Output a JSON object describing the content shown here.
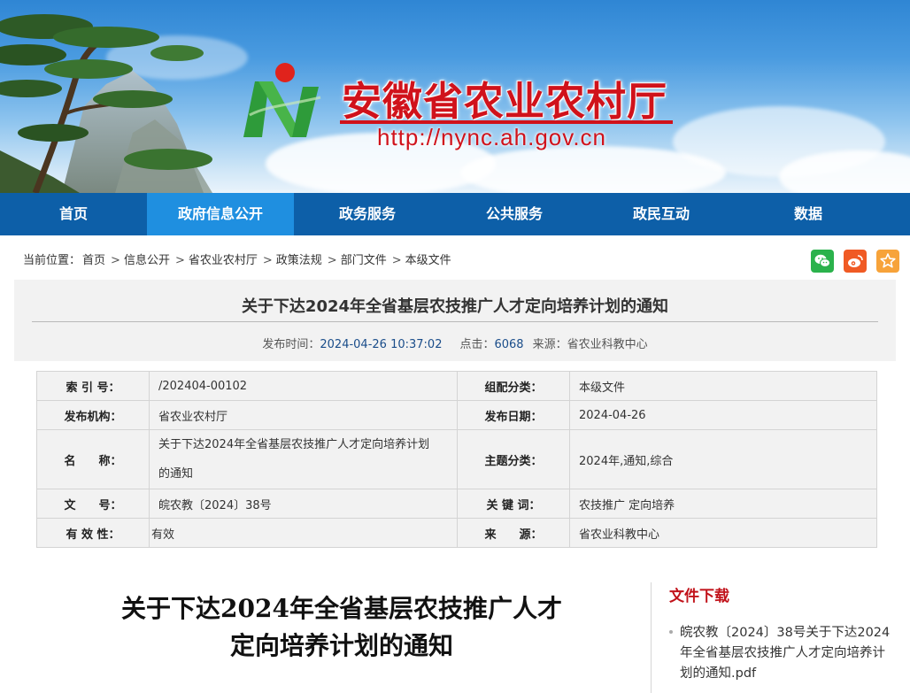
{
  "site": {
    "title": "安徽省农业农村厅",
    "url": "http://nync.ah.gov.cn"
  },
  "nav": {
    "items": [
      "首页",
      "政府信息公开",
      "政务服务",
      "公共服务",
      "政民互动",
      "数据"
    ],
    "active_index": 1
  },
  "breadcrumb": {
    "prefix": "当前位置：",
    "items": [
      "首页",
      "信息公开",
      "省农业农村厅",
      "政策法规",
      "部门文件",
      "本级文件"
    ],
    "separator": ">"
  },
  "share": {
    "icons": [
      "wechat-icon",
      "weibo-icon",
      "favorite-star-icon"
    ],
    "colors": [
      "#2bb24c",
      "#f05a24",
      "#f7a33a"
    ]
  },
  "article": {
    "title": "关于下达2024年全省基层农技推广人才定向培养计划的通知",
    "publish_label": "发布时间：",
    "publish_time": "2024-04-26 10:37:02",
    "clicks_label": "点击：",
    "clicks": "6068",
    "source_label": "来源：",
    "source": "省农业科教中心"
  },
  "info": {
    "index_label": "索 引 号：",
    "index_value": "/202404-00102",
    "category_label": "组配分类：",
    "category_value": "本级文件",
    "org_label": "发布机构：",
    "org_value": "省农业农村厅",
    "date_label": "发布日期：",
    "date_value": "2024-04-26",
    "name_label": "名　　称：",
    "name_value_1": "关于下达2024年全省基层农技推广人才定向培养计划",
    "name_value_2": "的通知",
    "topic_label": "主题分类：",
    "topic_value": "2024年,通知,综合",
    "docno_label": "文　　号：",
    "docno_value": "皖农教〔2024〕38号",
    "keyword_label": "关 键 词：",
    "keyword_value": "农技推广 定向培养",
    "valid_label": "有 效 性：",
    "valid_value": "有效",
    "src_label": "来　　源：",
    "src_value": "省农业科教中心"
  },
  "body": {
    "title_line1": "关于下达2024年全省基层农技推广人才",
    "title_line2": "定向培养计划的通知"
  },
  "download": {
    "heading": "文件下载",
    "file": "皖农教〔2024〕38号关于下达2024年全省基层农技推广人才定向培养计划的通知.pdf"
  },
  "colors": {
    "nav": "#0d5fa8",
    "nav_active": "#1f8fe0",
    "title_red": "#d0121b"
  }
}
